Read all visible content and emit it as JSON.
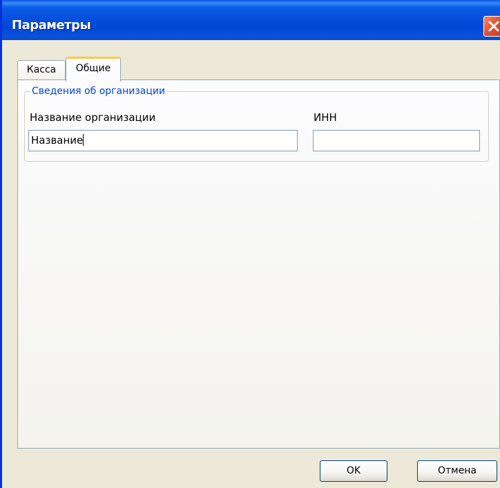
{
  "window": {
    "title": "Параметры"
  },
  "tabs": [
    {
      "label": "Касса",
      "active": false
    },
    {
      "label": "Общие",
      "active": true
    }
  ],
  "group": {
    "title": "Сведения об организации",
    "org_name_label": "Название организации",
    "org_name_value": "Название",
    "inn_label": "ИНН",
    "inn_value": ""
  },
  "buttons": {
    "ok": "OK",
    "cancel": "Отмена"
  },
  "colors": {
    "titlebar": "#0550DD",
    "accent_tab": "#FFC83C",
    "group_title": "#0046D5",
    "dialog_bg": "#ECE9D8"
  }
}
